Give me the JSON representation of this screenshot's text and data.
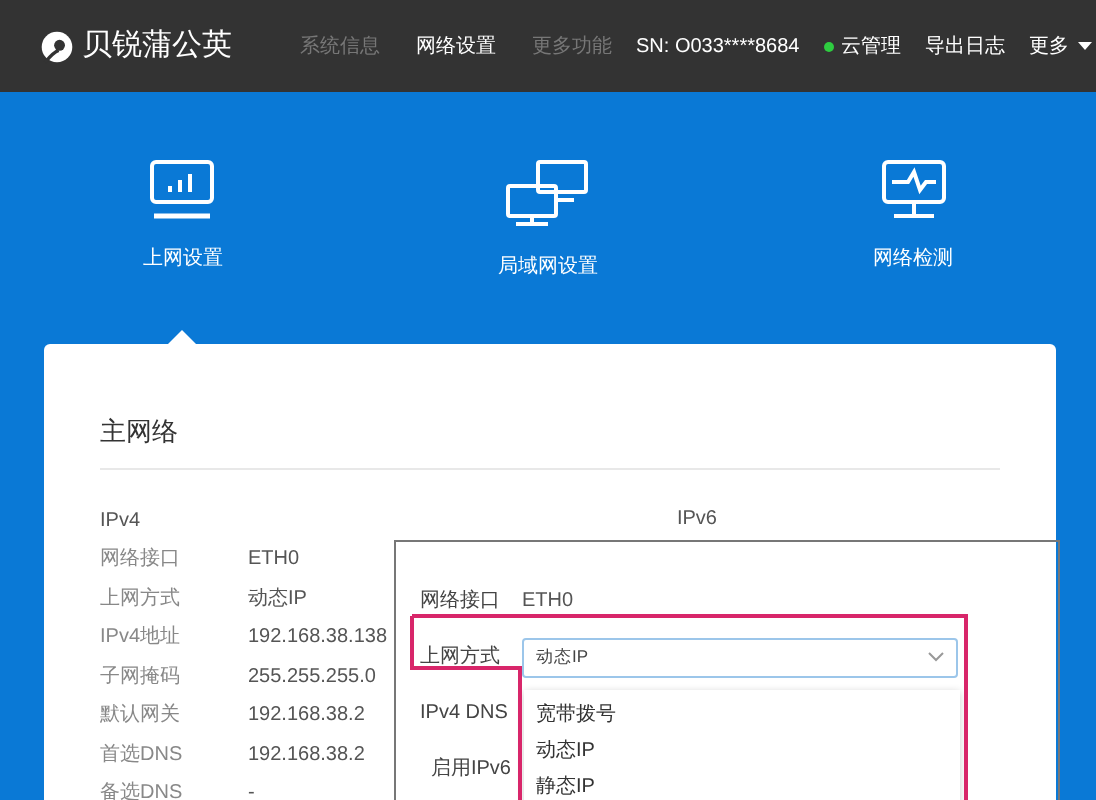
{
  "brand": "贝锐蒲公英",
  "nav_links": [
    {
      "label": "系统信息",
      "selected": false
    },
    {
      "label": "网络设置",
      "selected": true
    },
    {
      "label": "更多功能",
      "selected": false
    }
  ],
  "header_right": {
    "sn": "SN: O033****8684",
    "cloud": {
      "label": "云管理",
      "online": true
    },
    "export_log": "导出日志",
    "more": "更多"
  },
  "tabs": [
    {
      "label": "上网设置",
      "kind": "monitor",
      "selected": true
    },
    {
      "label": "局域网设置",
      "kind": "lan",
      "selected": false
    },
    {
      "label": "网络检测",
      "kind": "pulse",
      "selected": false
    }
  ],
  "card": {
    "title": "主网络",
    "ipv4": {
      "heading": "IPv4",
      "rows": [
        {
          "label": "网络接口",
          "value": "ETH0"
        },
        {
          "label": "上网方式",
          "value": "动态IP"
        },
        {
          "label": "IPv4地址",
          "value": "192.168.38.138"
        },
        {
          "label": "子网掩码",
          "value": "255.255.255.0"
        },
        {
          "label": "默认网关",
          "value": "192.168.38.2"
        },
        {
          "label": "首选DNS",
          "value": "192.168.38.2"
        },
        {
          "label": "备选DNS",
          "value": "-"
        }
      ]
    },
    "ipv6": {
      "heading": "IPv6",
      "panel": {
        "interface_label": "网络接口",
        "interface_value": "ETH0",
        "mode_label": "上网方式",
        "mode_value": "动态IP",
        "dns_label": "IPv4 DNS",
        "enable_label": "启用IPv6",
        "options": [
          {
            "label": "宽带拨号"
          },
          {
            "label": "动态IP"
          },
          {
            "label": "静态IP"
          }
        ]
      }
    }
  }
}
